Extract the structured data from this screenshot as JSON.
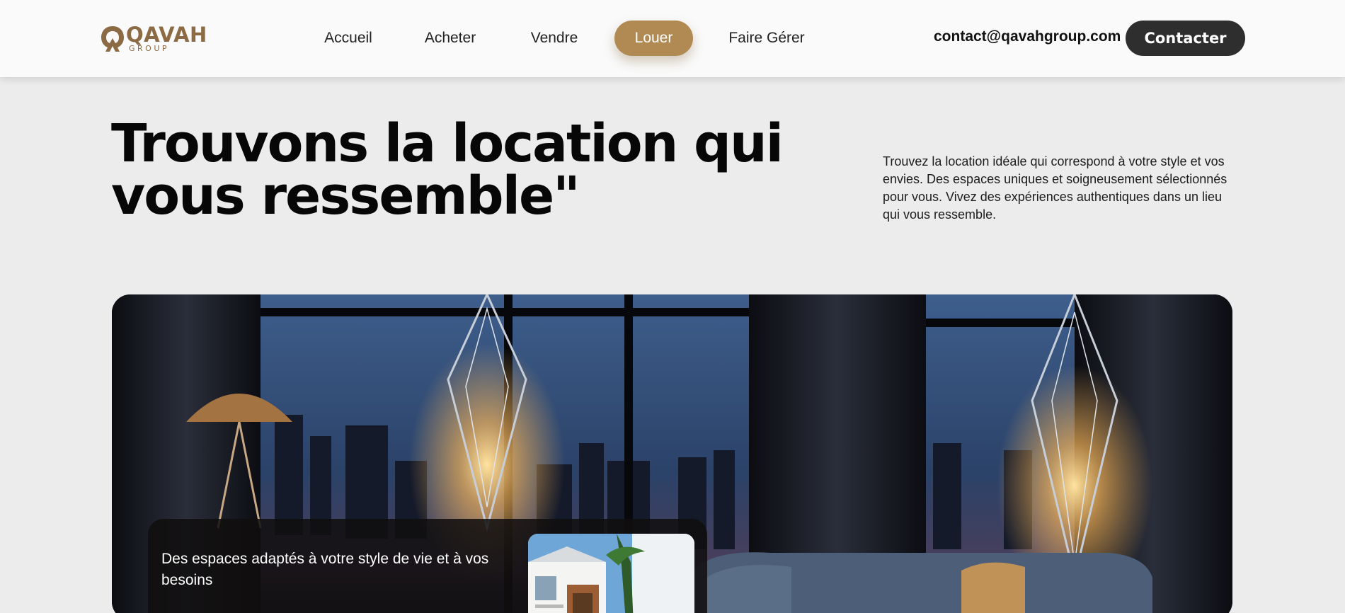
{
  "brand": {
    "name": "QAVAH",
    "tagline": "GROUP",
    "color": "#8c6a44"
  },
  "nav": {
    "items": [
      {
        "label": "Accueil",
        "active": false
      },
      {
        "label": "Acheter",
        "active": false
      },
      {
        "label": "Vendre",
        "active": false
      },
      {
        "label": "Louer",
        "active": true
      },
      {
        "label": "Faire Gérer",
        "active": false
      }
    ],
    "email": "contact@qavahgroup.com",
    "cta_label": "Contacter",
    "accent": "#b18a53"
  },
  "hero": {
    "title_line1": "Trouvons la location qui",
    "title_line2": "vous ressemble\"",
    "description": "Trouvez la location idéale qui correspond à votre style et vos envies. Des espaces uniques et soigneusement sélectionnés pour vous. Vivez des expériences authentiques dans un lieu qui vous ressemble."
  },
  "feature_card": {
    "text": "Des espaces adaptés à votre style de vie et à vos besoins"
  }
}
